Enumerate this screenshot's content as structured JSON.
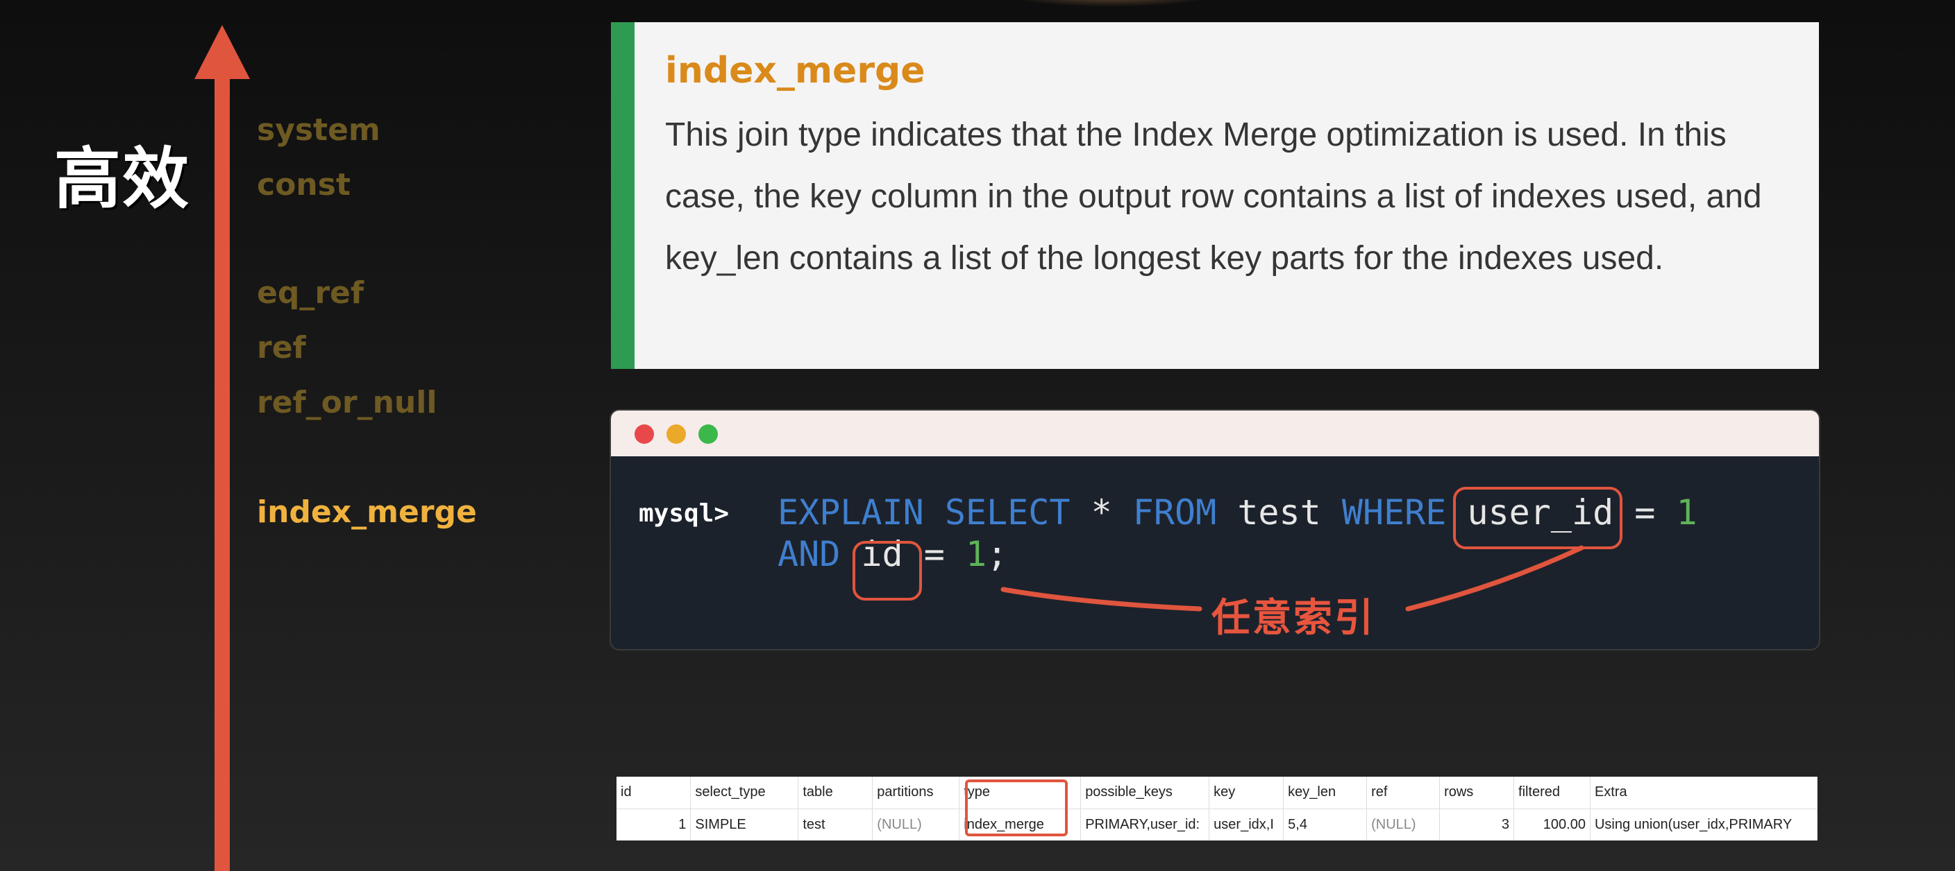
{
  "left": {
    "efficiency_label": "高效",
    "join_types": [
      {
        "label": "system",
        "active": false
      },
      {
        "label": "const",
        "active": false
      },
      {
        "label": "eq_ref",
        "active": false
      },
      {
        "label": "ref",
        "active": false
      },
      {
        "label": "ref_or_null",
        "active": false
      },
      {
        "label": "index_merge",
        "active": true
      }
    ]
  },
  "doc": {
    "title": "index_merge",
    "body": "This join type indicates that the Index Merge optimization is used. In this case, the key column in the output row contains a list of indexes used, and key_len contains a list of the longest key parts for the indexes used."
  },
  "terminal": {
    "prompt": "mysql>",
    "line1": {
      "explain": "EXPLAIN",
      "select": "SELECT",
      "star": "*",
      "from": "FROM",
      "table": "test",
      "where": "WHERE",
      "col1": "user_id",
      "eq": "=",
      "val1": "1"
    },
    "line2": {
      "and": "AND",
      "col2": "id",
      "eq": "=",
      "val2": "1",
      "semi": ";"
    },
    "annotation": "任意索引"
  },
  "result": {
    "headers": [
      "id",
      "select_type",
      "table",
      "partitions",
      "type",
      "possible_keys",
      "key",
      "key_len",
      "ref",
      "rows",
      "filtered",
      "Extra"
    ],
    "row": [
      "1",
      "SIMPLE",
      "test",
      "(NULL)",
      "index_merge",
      "PRIMARY,user_id:",
      "user_idx,I",
      "5,4",
      "(NULL)",
      "3",
      "100.00",
      "Using union(user_idx,PRIMARY"
    ]
  },
  "colors": {
    "arrow": "#e0553e",
    "doc_accent_bar": "#2f9a52",
    "doc_title": "#d98a1a",
    "join_inactive": "#6e5a22",
    "join_active": "#f0b23e",
    "sql_keyword": "#3f7fcf",
    "sql_number": "#5fb35a",
    "highlight": "#e0553e"
  }
}
